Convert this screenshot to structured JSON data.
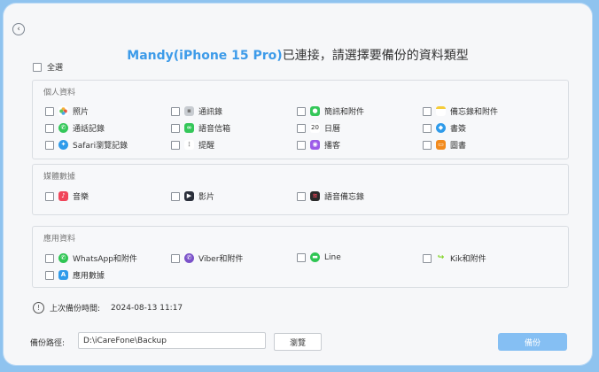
{
  "header": {
    "device_name": "Mandy(iPhone 15 Pro)",
    "title_suffix": "已連接，請選擇要備份的資料類型"
  },
  "select_all_label": "全選",
  "groups": {
    "personal": {
      "title": "個人資料",
      "items": [
        {
          "label": "照片",
          "icon": "photos-icon",
          "color": "#f2a33a"
        },
        {
          "label": "通訊錄",
          "icon": "contacts-icon",
          "color": "#9ba1a8"
        },
        {
          "label": "簡訊和附件",
          "icon": "messages-icon",
          "color": "#34c759"
        },
        {
          "label": "備忘錄和附件",
          "icon": "notes-icon",
          "color": "#f5cc3a"
        },
        {
          "label": "通話記錄",
          "icon": "phone-icon",
          "color": "#34c759"
        },
        {
          "label": "語音信箱",
          "icon": "voicemail-icon",
          "color": "#34c759"
        },
        {
          "label": "日曆",
          "icon": "calendar-icon",
          "color": "#ffffff"
        },
        {
          "label": "書簽",
          "icon": "bookmark-icon",
          "color": "#2f9bea"
        },
        {
          "label": "Safari瀏覽記錄",
          "icon": "safari-icon",
          "color": "#2f9bea"
        },
        {
          "label": "提醒",
          "icon": "reminders-icon",
          "color": "#ffffff"
        },
        {
          "label": "播客",
          "icon": "podcasts-icon",
          "color": "#9c5ce8"
        },
        {
          "label": "圖書",
          "icon": "books-icon",
          "color": "#f28a1c"
        }
      ]
    },
    "media": {
      "title": "媒體數據",
      "items": [
        {
          "label": "音樂",
          "icon": "music-icon",
          "color": "#f0455a"
        },
        {
          "label": "影片",
          "icon": "video-icon",
          "color": "#2a2f3a"
        },
        {
          "label": "語音備忘錄",
          "icon": "voice-memo-icon",
          "color": "#2a2a2a"
        }
      ]
    },
    "apps": {
      "title": "應用資料",
      "items": [
        {
          "label": "WhatsApp和附件",
          "icon": "whatsapp-icon",
          "color": "#2fc553"
        },
        {
          "label": "Viber和附件",
          "icon": "viber-icon",
          "color": "#7b52c9"
        },
        {
          "label": "Line",
          "icon": "line-icon",
          "color": "#2fc553"
        },
        {
          "label": "Kik和附件",
          "icon": "kik-icon",
          "color": "#7fd321"
        },
        {
          "label": "應用數據",
          "icon": "app-store-icon",
          "color": "#2f9bea"
        }
      ]
    }
  },
  "last_backup": {
    "label": "上次備份時間:",
    "value": "2024-08-13 11:17"
  },
  "path": {
    "label": "備份路徑:",
    "value": "D:\\iCareFone\\Backup",
    "browse_label": "瀏覽"
  },
  "backup_button_label": "備份",
  "colors": {
    "accent": "#3d9be9",
    "backup_button": "#85bff3",
    "frame": "#8fc3ef"
  }
}
